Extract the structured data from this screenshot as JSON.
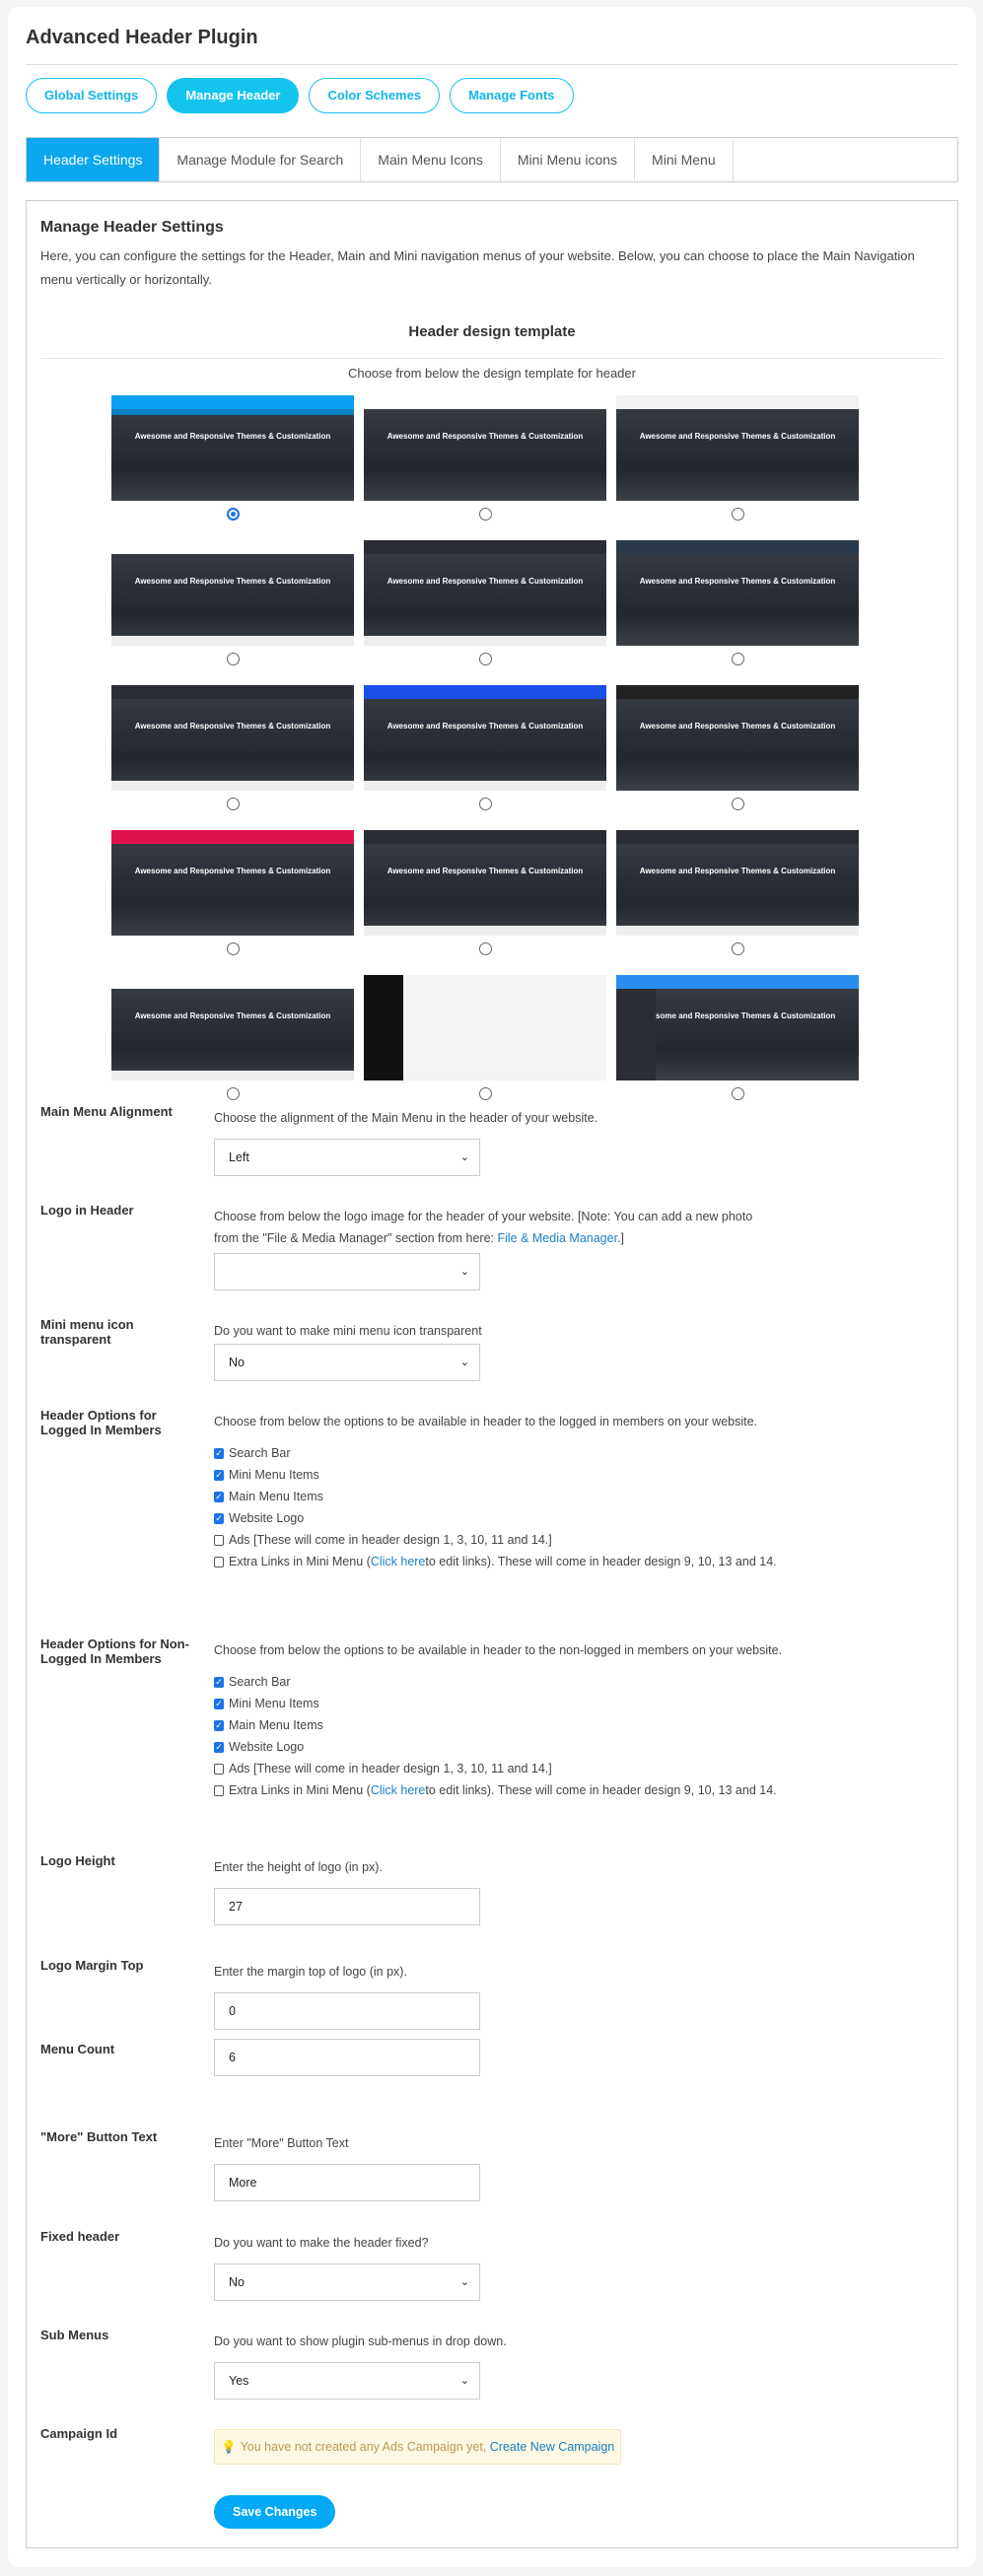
{
  "title": "Advanced Header Plugin",
  "pills": [
    {
      "label": "Global Settings",
      "active": false
    },
    {
      "label": "Manage Header",
      "active": true
    },
    {
      "label": "Color Schemes",
      "active": false
    },
    {
      "label": "Manage Fonts",
      "active": false
    }
  ],
  "tabs": [
    {
      "label": "Header Settings",
      "active": true
    },
    {
      "label": "Manage Module for Search"
    },
    {
      "label": "Main Menu Icons"
    },
    {
      "label": "Mini Menu icons"
    },
    {
      "label": "Mini Menu"
    }
  ],
  "section": {
    "title": "Manage Header Settings",
    "description": "Here, you can configure the settings for the Header, Main and Mini navigation menus of your website. Below, you can choose to place the Main Navigation menu vertically or horizontally."
  },
  "templates": {
    "title": "Header design template",
    "subtitle": "Choose from below the design template for header",
    "preview_heading": "Awesome and Responsive Themes & Customization",
    "selected": 1,
    "bar_colors": [
      "#0a9ff0",
      "#ffffff",
      "#f2f2f2",
      "#ffffff",
      "#2a2d33",
      "#2b3a4a",
      "#2a2d33",
      "#1a4fe8",
      "#222222",
      "#e0134f",
      "#2a2d33",
      "#2a2d33",
      "#ffffff",
      "#ffffff",
      "#2a8ef0"
    ]
  },
  "accent": "#13c5ee",
  "form": {
    "alignment": {
      "label": "Main Menu Alignment",
      "help": "Choose the alignment of the Main Menu in the header of your website.",
      "value": "Left"
    },
    "logo": {
      "label": "Logo in Header",
      "help": "Choose from below the logo image for the header of your website. [Note: You can add a new photo from the \"File & Media Manager\" section from here: ",
      "link": "File & Media Manager",
      "help_end": ".]",
      "value": ""
    },
    "mini_icon": {
      "label": "Mini menu icon transparent",
      "help": "Do you want to make mini menu icon transparent",
      "value": "No"
    },
    "logged": {
      "label": "Header Options for Logged In Members",
      "help": "Choose from below the options to be available in header to the logged in members on your website.",
      "options": [
        {
          "label": "Search Bar",
          "checked": true
        },
        {
          "label": "Mini Menu Items",
          "checked": true
        },
        {
          "label": "Main Menu Items",
          "checked": true
        },
        {
          "label": "Website Logo",
          "checked": true
        },
        {
          "label": "Ads [These will come in header design 1, 3, 10, 11 and 14.]",
          "checked": false
        }
      ],
      "extra": {
        "pre": "Extra Links in Mini Menu (",
        "link": "Click here",
        "post": " to edit links). These will come in header design 9, 10, 13 and 14.",
        "checked": false
      }
    },
    "nonlogged": {
      "label": "Header Options for Non-Logged In Members",
      "help": "Choose from below the options to be available in header to the non-logged in members on your website.",
      "options": [
        {
          "label": "Search Bar",
          "checked": true
        },
        {
          "label": "Mini Menu Items",
          "checked": true
        },
        {
          "label": "Main Menu Items",
          "checked": true
        },
        {
          "label": "Website Logo",
          "checked": true
        },
        {
          "label": "Ads [These will come in header design 1, 3, 10, 11 and 14.]",
          "checked": false
        }
      ],
      "extra": {
        "pre": "Extra Links in Mini Menu (",
        "link": "Click here",
        "post": " to edit links). These will come in header design 9, 10, 13 and 14.",
        "checked": false
      }
    },
    "logo_height": {
      "label": "Logo Height",
      "help": "Enter the height of logo (in px).",
      "value": "27"
    },
    "logo_margin": {
      "label": "Logo Margin Top",
      "help": "Enter the margin top of logo (in px).",
      "value": "0"
    },
    "menu_count": {
      "label": "Menu Count",
      "value": "6"
    },
    "more_text": {
      "label": "\"More\" Button Text",
      "help": "Enter \"More\" Button Text",
      "value": "More"
    },
    "fixed": {
      "label": "Fixed header",
      "help": "Do you want to make the header fixed?",
      "value": "No"
    },
    "submenus": {
      "label": "Sub Menus",
      "help": "Do you want to show plugin sub-menus in drop down.",
      "value": "Yes"
    },
    "campaign": {
      "label": "Campaign Id",
      "message": "You have not created any Ads Campaign yet,",
      "link": "Create New Campaign"
    },
    "save": "Save Changes"
  }
}
